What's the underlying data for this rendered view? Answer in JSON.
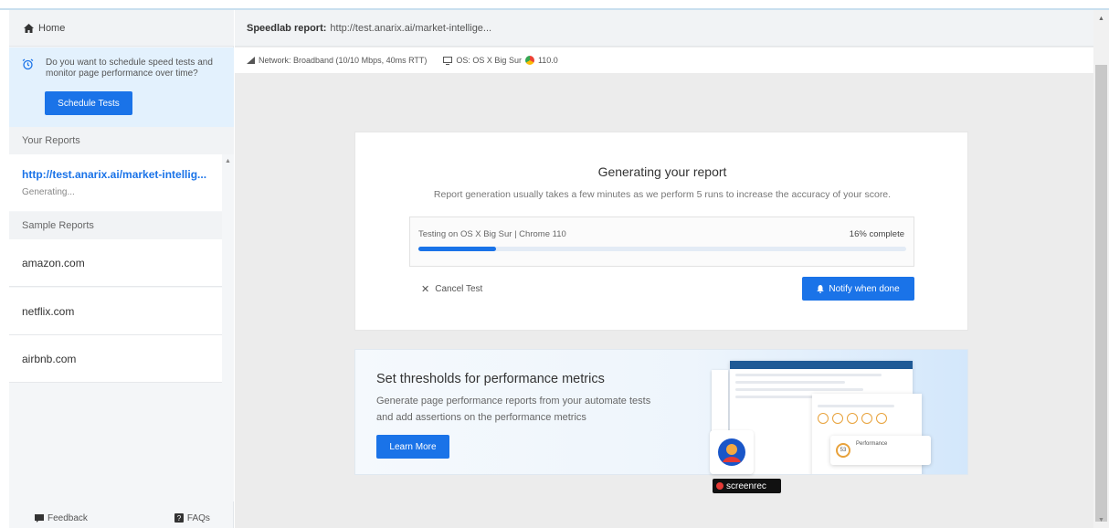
{
  "sidebar": {
    "home_label": "Home",
    "promo_text": "Do you want to schedule speed tests and monitor page performance over time?",
    "schedule_button": "Schedule Tests",
    "your_reports_label": "Your Reports",
    "reports": [
      {
        "url": "http://test.anarix.ai/market-intellig...",
        "status": "Generating..."
      }
    ],
    "sample_reports_label": "Sample Reports",
    "samples": [
      "amazon.com",
      "netflix.com",
      "airbnb.com"
    ],
    "footer": {
      "feedback": "Feedback",
      "faqs": "FAQs"
    }
  },
  "header": {
    "label": "Speedlab report:",
    "url": "http://test.anarix.ai/market-intellige..."
  },
  "subheader": {
    "network": "Network: Broadband (10/10 Mbps, 40ms RTT)",
    "os": "OS: OS X Big Sur",
    "browser_version": "110.0"
  },
  "report_card": {
    "title": "Generating your report",
    "subtitle": "Report generation usually takes a few minutes as we perform 5 runs to increase the accuracy of your score.",
    "testing_label": "Testing on OS X Big Sur | Chrome 110",
    "percent_label": "16% complete",
    "progress": 0.16,
    "cancel_label": "Cancel Test",
    "notify_label": "Notify when done"
  },
  "banner": {
    "title": "Set thresholds for performance metrics",
    "text": "Generate page performance reports from your automate tests and add assertions on the performance metrics",
    "button": "Learn More",
    "mock_score": "53",
    "mock_perf_label": "Performance"
  },
  "overlay": {
    "screenrec_label": "screenrec"
  },
  "colors": {
    "accent": "#1a73e8",
    "promo_bg": "#e3f1fd"
  }
}
